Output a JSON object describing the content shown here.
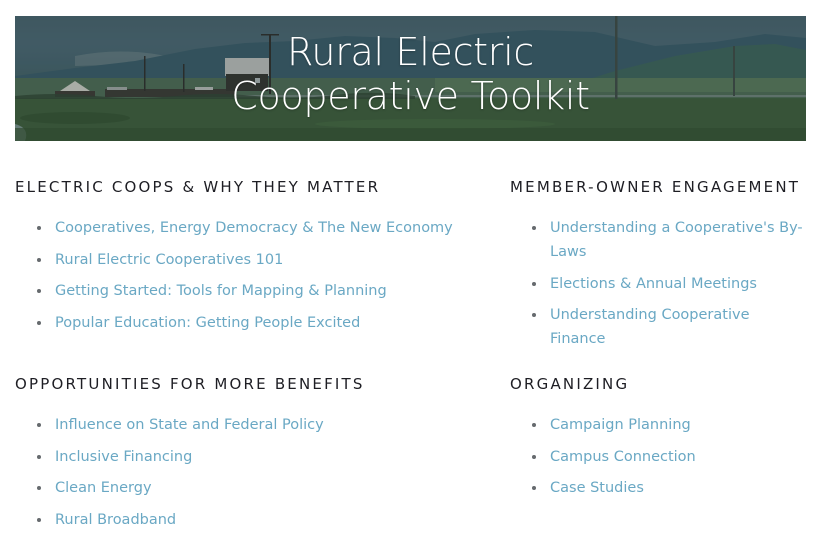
{
  "banner": {
    "title_line1": "Rural Electric",
    "title_line2": "Cooperative Toolkit",
    "image_description": "rural-landscape-photo"
  },
  "colors": {
    "link": "#6aa8c4",
    "heading": "#1e1e24",
    "bullet": "#666a6e"
  },
  "sections": [
    {
      "heading": "ELECTRIC COOPS & WHY THEY MATTER",
      "links": [
        "Cooperatives, Energy Democracy & The New Economy",
        "Rural Electric Cooperatives 101",
        "Getting Started: Tools for Mapping & Planning",
        "Popular Education: Getting People Excited"
      ]
    },
    {
      "heading": "MEMBER-OWNER ENGAGEMENT",
      "links": [
        "Understanding a Cooperative's By-Laws",
        "Elections & Annual Meetings",
        "Understanding Cooperative Finance"
      ]
    },
    {
      "heading": "OPPORTUNITIES FOR MORE BENEFITS",
      "links": [
        "Influence on State and Federal Policy",
        "Inclusive Financing",
        "Clean Energy",
        "Rural Broadband"
      ]
    },
    {
      "heading": "ORGANIZING",
      "links": [
        "Campaign Planning",
        "Campus Connection",
        "Case Studies"
      ]
    }
  ]
}
